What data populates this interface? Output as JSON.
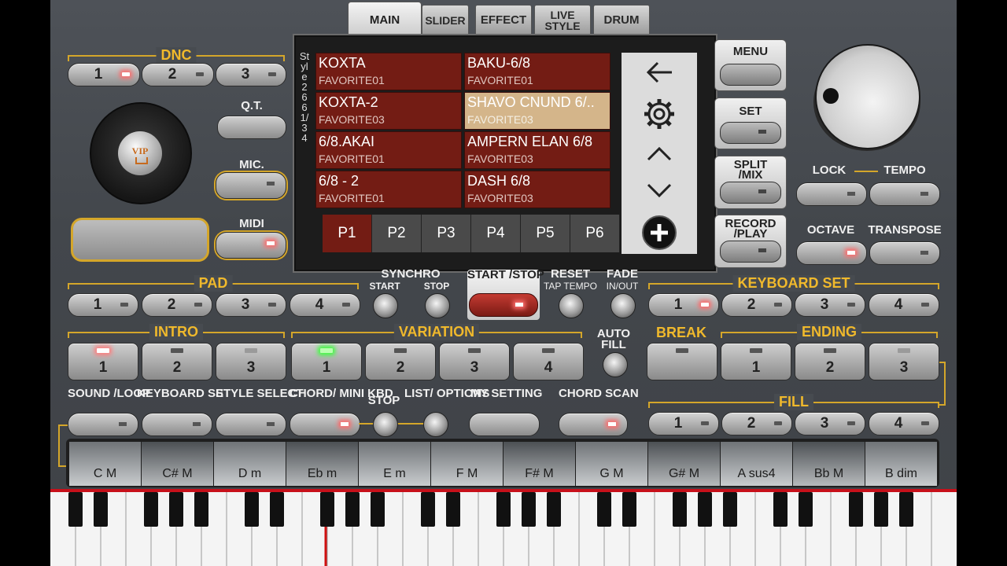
{
  "tabs": [
    {
      "label": "MAIN",
      "active": true
    },
    {
      "label": "SLIDER"
    },
    {
      "label": "EFFECT"
    },
    {
      "label": "LIVE STYLE"
    },
    {
      "label": "DRUM"
    }
  ],
  "left": {
    "dnc_title": "DNC",
    "dnc_buttons": [
      "1",
      "2",
      "3"
    ],
    "qt_label": "Q.T.",
    "mic_label": "MIC.",
    "midi_label": "MIDI",
    "vip_label": "VIP"
  },
  "screen": {
    "vertical_label": "Style 266 1/34",
    "styles": [
      {
        "name": "KOXTA",
        "fav": "FAVORITE01"
      },
      {
        "name": "BAKU-6/8",
        "fav": "FAVORITE01"
      },
      {
        "name": "KOXTA-2",
        "fav": "FAVORITE03"
      },
      {
        "name": "SHAVO CNUND 6/..",
        "fav": "FAVORITE03",
        "selected": true
      },
      {
        "name": "6/8.AKAI",
        "fav": "FAVORITE01"
      },
      {
        "name": "AMPERN ELAN 6/8",
        "fav": "FAVORITE03"
      },
      {
        "name": "6/8 - 2",
        "fav": "FAVORITE01"
      },
      {
        "name": "DASH 6/8",
        "fav": "FAVORITE03"
      }
    ],
    "pages": [
      "P1",
      "P2",
      "P3",
      "P4",
      "P5",
      "P6"
    ],
    "active_page": "P1",
    "side_icons": [
      "back-arrow-icon",
      "gear-icon",
      "chevron-up-icon",
      "chevron-down-icon",
      "add-circle-icon"
    ]
  },
  "right": {
    "menu": "MENU",
    "set": "SET",
    "split_mix": "SPLIT /MIX",
    "record_play": "RECORD /PLAY",
    "lock": "LOCK",
    "tempo": "TEMPO",
    "octave": "OCTAVE",
    "transpose": "TRANSPOSE"
  },
  "pad": {
    "title": "PAD",
    "buttons": [
      "1",
      "2",
      "3",
      "4"
    ]
  },
  "synchro": {
    "title": "SYNCHRO",
    "start": "START",
    "stop": "STOP"
  },
  "start_stop": "START /STOP",
  "reset": {
    "title": "RESET",
    "sub": "TAP TEMPO"
  },
  "fade": {
    "title": "FADE",
    "sub": "IN/OUT"
  },
  "keyboard_set": {
    "title": "KEYBOARD SET",
    "buttons": [
      "1",
      "2",
      "3",
      "4"
    ]
  },
  "intro": {
    "title": "INTRO",
    "buttons": [
      "1",
      "2",
      "3"
    ]
  },
  "variation": {
    "title": "VARIATION",
    "buttons": [
      "1",
      "2",
      "3",
      "4"
    ]
  },
  "auto_fill": "AUTO FILL",
  "break_label": "BREAK",
  "ending": {
    "title": "ENDING",
    "buttons": [
      "1",
      "2",
      "3"
    ]
  },
  "bottom_row": {
    "sound_loop": "SOUND /LOOP",
    "keyboard_set": "KEYBOARD SET",
    "style_select": "STYLE SELECT",
    "chord_mini_kbd": "CHORD/ MINI KBD",
    "stop": "STOP",
    "list_options": "LIST/ OPTIONS",
    "my_setting": "MY SETTING",
    "chord_scan": "CHORD SCAN"
  },
  "fill": {
    "title": "FILL",
    "buttons": [
      "1",
      "2",
      "3",
      "4"
    ]
  },
  "chords": [
    "C M",
    "C# M",
    "D m",
    "Eb m",
    "E m",
    "F M",
    "F# M",
    "G M",
    "G# M",
    "A sus4",
    "Bb M",
    "B dim"
  ],
  "colors": {
    "accent": "#f0b92c",
    "style_cell": "#731c14",
    "selected_cell": "#d4b58a",
    "led": "#ff6a6a",
    "led_green": "#3cff3c"
  }
}
